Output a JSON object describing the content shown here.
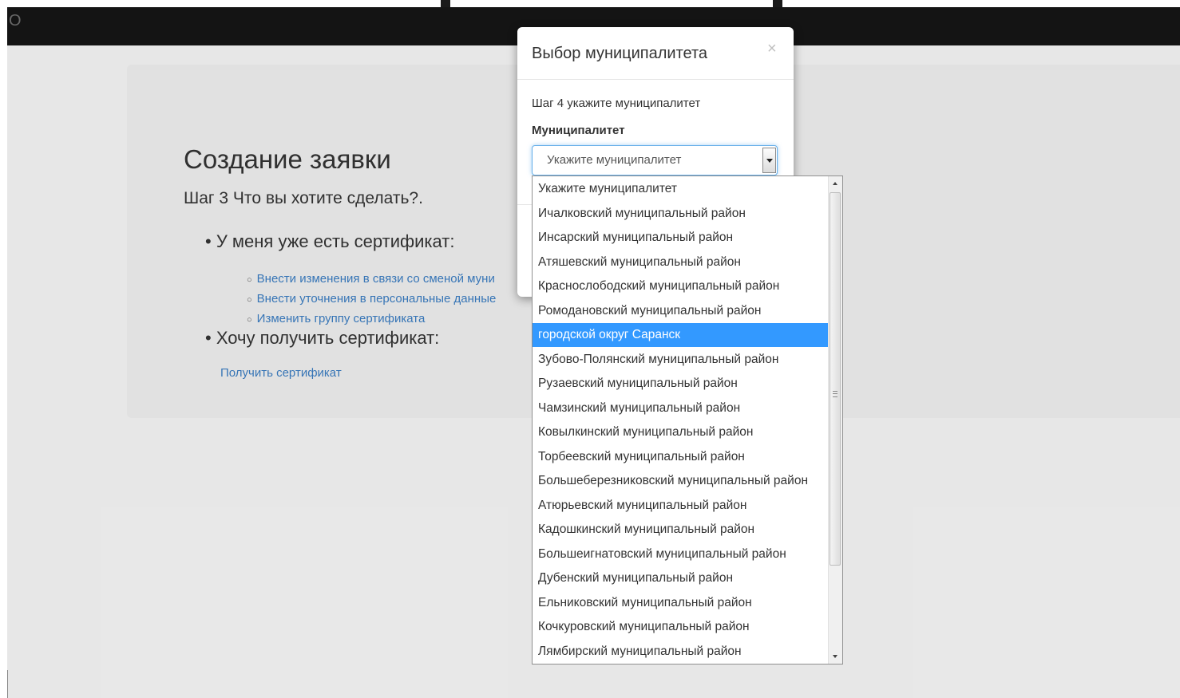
{
  "navbar": {
    "brand": "О"
  },
  "main": {
    "title": "Создание заявки",
    "step": "Шаг 3 Что вы хотите сделать?.",
    "section1": {
      "label": "У меня уже есть сертификат:",
      "links": [
        "Внести изменения в связи со сменой муни",
        "Внести уточнения в персональные данные",
        "Изменить группу сертификата"
      ]
    },
    "section2": {
      "label": "Хочу получить сертификат:",
      "link": "Получить сертификат"
    }
  },
  "modal": {
    "title": "Выбор муниципалитета",
    "close_glyph": "×",
    "step": "Шаг 4 укажите муниципалитет",
    "field_label": "Муниципалитет",
    "select_value": "Укажите муниципалитет",
    "selected_index": 6,
    "options": [
      "Укажите муниципалитет",
      "Ичалковский муниципальный район",
      "Инсарский муниципальный район",
      "Атяшевский муниципальный район",
      "Краснослободский муниципальный район",
      "Ромодановский муниципальный район",
      "городской округ Саранск",
      "Зубово-Полянский муниципальный район",
      "Рузаевский муниципальный район",
      "Чамзинский муниципальный район",
      "Ковылкинский муниципальный район",
      "Торбеевский муниципальный район",
      "Большеберезниковский муниципальный район",
      "Атюрьевский муниципальный район",
      "Кадошкинский муниципальный район",
      "Большеигнатовский муниципальный район",
      "Дубенский муниципальный район",
      "Ельниковский муниципальный район",
      "Кочкуровский муниципальный район",
      "Лямбирский муниципальный район"
    ]
  },
  "colors": {
    "link": "#3a7cc0",
    "highlight": "#3399ff",
    "navbar": "#161616"
  }
}
